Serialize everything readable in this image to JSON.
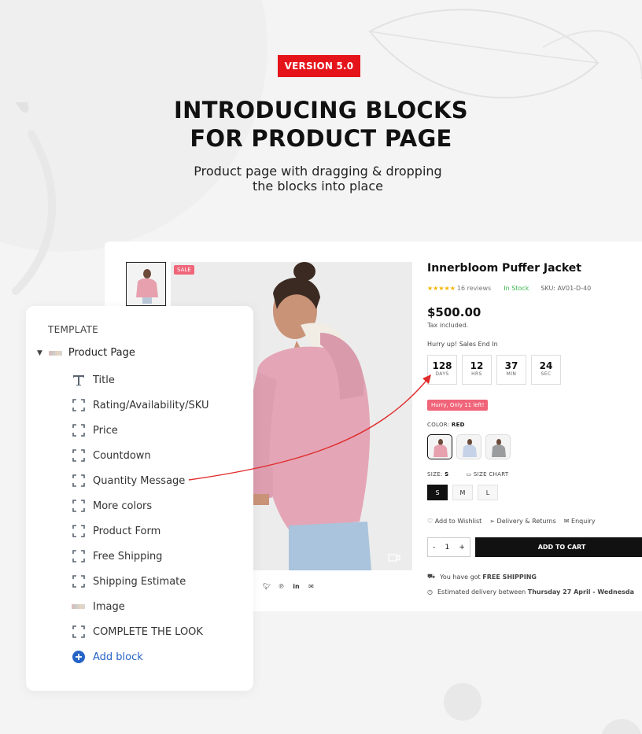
{
  "header": {
    "version_badge": "VERSION 5.0",
    "headline_line1": "INTRODUCING BLOCKS",
    "headline_line2": "FOR PRODUCT PAGE",
    "subline_line1": "Product page with dragging & dropping",
    "subline_line2": "the blocks into place"
  },
  "product": {
    "sale_badge": "SALE",
    "title": "Innerbloom Puffer Jacket",
    "stars": "★★★★★",
    "reviews": "16 reviews",
    "stock": "In Stock",
    "sku": "SKU: AV01-D-40",
    "price": "$500.00",
    "tax": "Tax included.",
    "hurry": "Hurry up! Sales End In",
    "countdown": [
      {
        "value": "128",
        "label": "DAYS"
      },
      {
        "value": "12",
        "label": "HRS"
      },
      {
        "value": "37",
        "label": "MIN"
      },
      {
        "value": "24",
        "label": "SEC"
      }
    ],
    "quantity_message": "Hurry, Only 11 left!",
    "color_label": "COLOR:",
    "color_value": "RED",
    "size_label": "SIZE:",
    "size_value": "S",
    "size_chart": "SIZE CHART",
    "sizes": [
      "S",
      "M",
      "L"
    ],
    "wishlist": "Add to Wishlist",
    "delivery": "Delivery & Returns",
    "enquiry": "Enquiry",
    "qty_minus": "-",
    "qty_value": "1",
    "qty_plus": "+",
    "add_to_cart": "ADD TO CART",
    "shipping_prefix": "You have got",
    "shipping_bold": "FREE SHIPPING",
    "estimate_prefix": "Estimated delivery between",
    "estimate_bold": "Thursday 27 April - Wednesda"
  },
  "template": {
    "header": "TEMPLATE",
    "root": "Product Page",
    "items": [
      {
        "label": "Title",
        "icon": "text-icon"
      },
      {
        "label": "Rating/Availability/SKU",
        "icon": "block-icon"
      },
      {
        "label": "Price",
        "icon": "block-icon"
      },
      {
        "label": "Countdown",
        "icon": "block-icon"
      },
      {
        "label": "Quantity Message",
        "icon": "block-icon"
      },
      {
        "label": "More colors",
        "icon": "block-icon"
      },
      {
        "label": "Product Form",
        "icon": "block-icon"
      },
      {
        "label": "Free Shipping",
        "icon": "block-icon"
      },
      {
        "label": "Shipping Estimate",
        "icon": "block-icon"
      },
      {
        "label": "Image",
        "icon": "image-icon"
      },
      {
        "label": "COMPLETE THE LOOK",
        "icon": "block-icon"
      },
      {
        "label": "Add block",
        "icon": "plus-circle-icon"
      }
    ]
  },
  "colors": {
    "accent_red": "#e5141a",
    "pink": "#f0657a",
    "link_blue": "#2563c7",
    "arrow_red": "#e02b2b"
  }
}
